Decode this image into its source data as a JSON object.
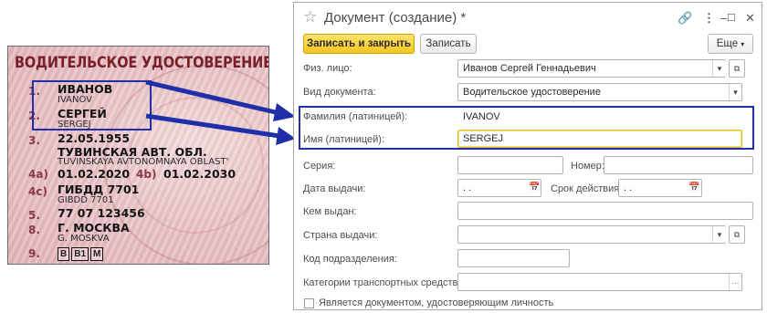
{
  "license": {
    "title": "ВОДИТЕЛЬСКОЕ УДОСТОВЕРЕНИЕ",
    "lines": [
      {
        "num": "1.",
        "main": "ИВАНОВ",
        "sub": "IVANOV"
      },
      {
        "num": "2.",
        "main": "СЕРГЕЙ",
        "sub": "SERGEJ"
      },
      {
        "num": "3.",
        "main": "22.05.1955",
        "sub": ""
      },
      {
        "num": "",
        "main": "ТУВИНСКАЯ АВТ. ОБЛ.",
        "sub": "TUVINSKAYA AVTONOMNAYA OBLAST'"
      },
      {
        "num_a": "4a)",
        "val_a": "01.02.2020",
        "num_b": "4b)",
        "val_b": "01.02.2030"
      },
      {
        "num": "4c)",
        "main": "ГИБДД 7701",
        "sub": "GIBDD 7701"
      },
      {
        "num": "5.",
        "main": "77 07 123456",
        "sub": ""
      },
      {
        "num": "8.",
        "main": "Г. МОСКВА",
        "sub": "G. MOSKVA"
      },
      {
        "num": "9.",
        "cats": [
          "B",
          "B1",
          "M"
        ]
      }
    ]
  },
  "window": {
    "title": "Документ (создание) *",
    "icons": [
      "link-icon",
      "more-vertical-icon",
      "minimize-icon",
      "maximize-icon",
      "close-icon"
    ],
    "toolbar": {
      "save_close": "Записать и закрыть",
      "save": "Записать",
      "more": "Еще"
    },
    "fields": {
      "person": {
        "label": "Физ. лицо:",
        "value": "Иванов Сергей Геннадьевич"
      },
      "doc_type": {
        "label": "Вид документа:",
        "value": "Водительское удостоверение"
      },
      "surname_lat": {
        "label": "Фамилия (латиницей):",
        "value": "IVANOV"
      },
      "name_lat": {
        "label": "Имя (латиницей):",
        "value": "SERGEJ"
      },
      "series": {
        "label": "Серия:",
        "value": ""
      },
      "number": {
        "label": "Номер:",
        "value": ""
      },
      "issue_date": {
        "label": "Дата выдачи:",
        "value": " .  ."
      },
      "valid_until": {
        "label": "Срок действия:",
        "value": " .  ."
      },
      "issued_by": {
        "label": "Кем выдан:",
        "value": ""
      },
      "country": {
        "label": "Страна выдачи:",
        "value": ""
      },
      "dept_code": {
        "label": "Код подразделения:",
        "value": ""
      },
      "vehicle_cats": {
        "label": "Категории транспортных средств:",
        "value": ""
      },
      "identity_doc": {
        "label": "Является документом, удостоверяющим личность",
        "checked": false
      }
    }
  },
  "colors": {
    "accent_blue": "#1f2fa8",
    "primary_button": "#f5c520",
    "focus_border": "#e6c12f"
  }
}
